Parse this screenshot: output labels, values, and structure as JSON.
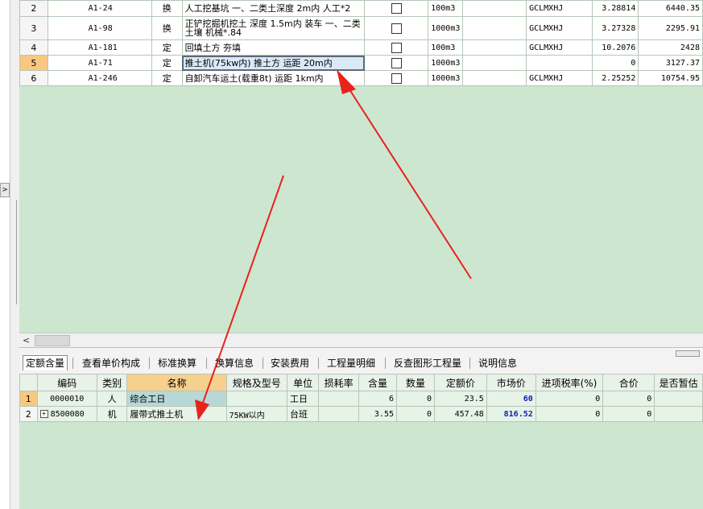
{
  "upper_table": {
    "rows": [
      {
        "rownum": "2",
        "code": "A1-24",
        "type": "换",
        "name": "人工挖基坑 一、二类土深度 2m内 人工*2",
        "unit": "100m3",
        "category": "GCLMXHJ",
        "qty": "3.28814",
        "amount": "6440.35"
      },
      {
        "rownum": "3",
        "code": "A1-98",
        "type": "换",
        "name": "正铲挖掘机挖土 深度 1.5m内 装车 一、二类土壤 机械*.84",
        "unit": "1000m3",
        "category": "GCLMXHJ",
        "qty": "3.27328",
        "amount": "2295.91"
      },
      {
        "rownum": "4",
        "code": "A1-181",
        "type": "定",
        "name": "回填土方 夯填",
        "unit": "100m3",
        "category": "GCLMXHJ",
        "qty": "10.2076",
        "amount": "2428"
      },
      {
        "rownum": "5",
        "code": "A1-71",
        "type": "定",
        "name": "推土机(75kw内) 推土方 运距 20m内",
        "unit": "1000m3",
        "category": "",
        "qty": "0",
        "amount": "3127.37"
      },
      {
        "rownum": "6",
        "code": "A1-246",
        "type": "定",
        "name": "自卸汽车运土(载重8t) 运距 1km内",
        "unit": "1000m3",
        "category": "GCLMXHJ",
        "qty": "2.25252",
        "amount": "10754.95"
      }
    ]
  },
  "scrollbar": {
    "left_arrow": "<"
  },
  "left_panel": {
    "expand_glyph": ">"
  },
  "tabs": [
    "定额含量",
    "查看单价构成",
    "标准换算",
    "换算信息",
    "安装费用",
    "工程量明细",
    "反查图形工程量",
    "说明信息"
  ],
  "lower_table": {
    "headers": [
      "编码",
      "类别",
      "名称",
      "规格及型号",
      "单位",
      "损耗率",
      "含量",
      "数量",
      "定额价",
      "市场价",
      "进项税率(%)",
      "合价",
      "是否暂估"
    ],
    "rows": [
      {
        "rownum": "1",
        "code": "0000010",
        "category": "人",
        "name": "综合工日",
        "spec": "",
        "unit": "工日",
        "loss": "",
        "content": "6",
        "quantity": "0",
        "quota_price": "23.5",
        "market_price": "60",
        "tax_rate": "0",
        "total": "0",
        "provisional": ""
      },
      {
        "rownum": "2",
        "expand": "+",
        "code": "8500080",
        "category": "机",
        "name": "履带式推土机",
        "spec": "75KW以内",
        "unit": "台班",
        "loss": "",
        "content": "3.55",
        "quantity": "0",
        "quota_price": "457.48",
        "market_price": "816.52",
        "tax_rate": "0",
        "total": "0",
        "provisional": ""
      }
    ]
  },
  "colors": {
    "background": "#cde6d0",
    "annotation_arrow": "#e8231b",
    "selected_row_header": "#f8c880",
    "highlight_header": "#f7cf8e",
    "market_price_text": "#1020c0"
  }
}
